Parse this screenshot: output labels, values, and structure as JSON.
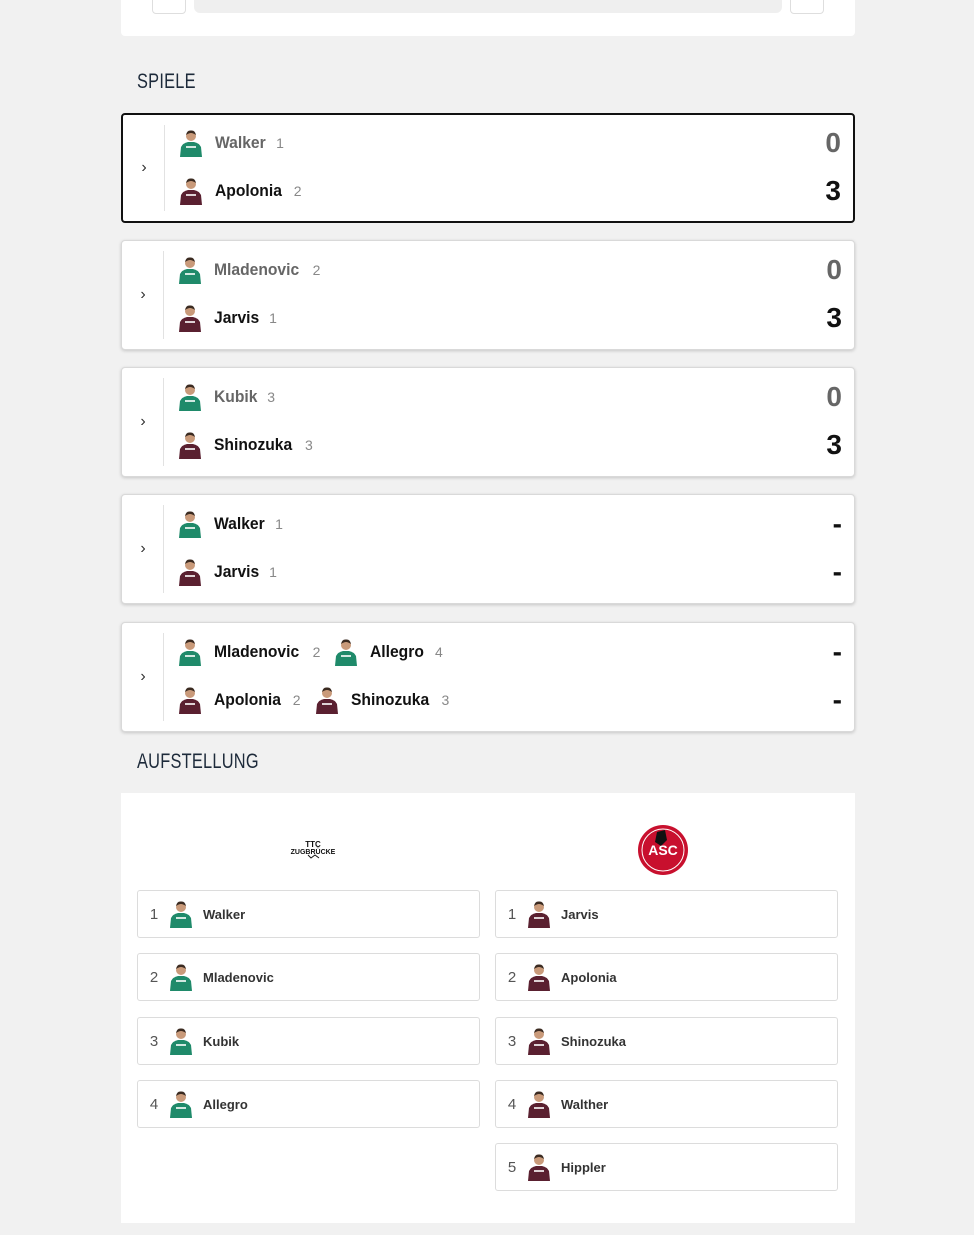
{
  "sections": {
    "games_title": "SPIELE",
    "lineup_title": "AUFSTELLUNG"
  },
  "colors": {
    "home_jersey": "#1f8a6a",
    "away_jersey": "#5a2030",
    "active_border": "#111111"
  },
  "matches": [
    {
      "active": true,
      "home": [
        {
          "name": "Walker",
          "seed": "1"
        }
      ],
      "away": [
        {
          "name": "Apolonia",
          "seed": "2"
        }
      ],
      "home_score": "0",
      "away_score": "3"
    },
    {
      "active": false,
      "home": [
        {
          "name": "Mladenovic",
          "seed": "2"
        }
      ],
      "away": [
        {
          "name": "Jarvis",
          "seed": "1"
        }
      ],
      "home_score": "0",
      "away_score": "3"
    },
    {
      "active": false,
      "home": [
        {
          "name": "Kubik",
          "seed": "3"
        }
      ],
      "away": [
        {
          "name": "Shinozuka",
          "seed": "3"
        }
      ],
      "home_score": "0",
      "away_score": "3"
    },
    {
      "active": false,
      "home": [
        {
          "name": "Walker",
          "seed": "1"
        }
      ],
      "away": [
        {
          "name": "Jarvis",
          "seed": "1"
        }
      ],
      "home_score": "-",
      "away_score": "-"
    },
    {
      "active": false,
      "home": [
        {
          "name": "Mladenovic",
          "seed": "2"
        },
        {
          "name": "Allegro",
          "seed": "4"
        }
      ],
      "away": [
        {
          "name": "Apolonia",
          "seed": "2"
        },
        {
          "name": "Shinozuka",
          "seed": "3"
        }
      ],
      "home_score": "-",
      "away_score": "-"
    }
  ],
  "lineup": {
    "home_logo_text": "TTC ZUGBRÜCKE",
    "away_logo_text": "ASC",
    "home": [
      {
        "num": "1",
        "name": "Walker"
      },
      {
        "num": "2",
        "name": "Mladenovic"
      },
      {
        "num": "3",
        "name": "Kubik"
      },
      {
        "num": "4",
        "name": "Allegro"
      }
    ],
    "away": [
      {
        "num": "1",
        "name": "Jarvis"
      },
      {
        "num": "2",
        "name": "Apolonia"
      },
      {
        "num": "3",
        "name": "Shinozuka"
      },
      {
        "num": "4",
        "name": "Walther"
      },
      {
        "num": "5",
        "name": "Hippler"
      }
    ]
  }
}
